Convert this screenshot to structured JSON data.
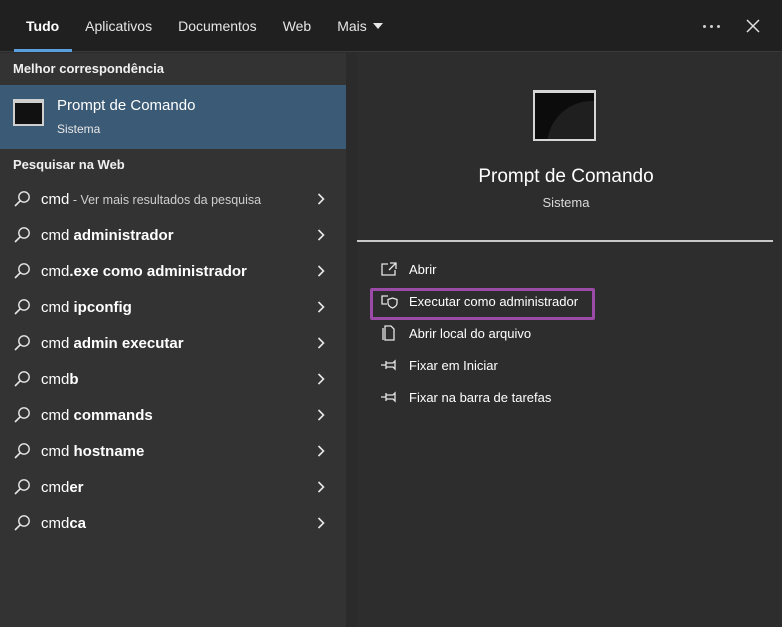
{
  "tabs": [
    {
      "label": "Tudo",
      "active": true
    },
    {
      "label": "Aplicativos"
    },
    {
      "label": "Documentos"
    },
    {
      "label": "Web"
    },
    {
      "label": "Mais"
    }
  ],
  "icons": {
    "more": "ellipsis-icon",
    "close": "close-icon",
    "dropdown": "caret-down-icon",
    "search": "search-icon",
    "chevron": "chevron-right-icon"
  },
  "best_match": {
    "header": "Melhor correspondência",
    "title": "Prompt de Comando",
    "subtitle": "Sistema"
  },
  "web": {
    "header": "Pesquisar na Web",
    "results": [
      {
        "prefix": "cmd",
        "bold": "",
        "note": " - Ver mais resultados da pesquisa"
      },
      {
        "prefix": "cmd ",
        "bold": "administrador",
        "note": ""
      },
      {
        "prefix": "cmd",
        "bold": ".exe como administrador",
        "note": ""
      },
      {
        "prefix": "cmd ",
        "bold": "ipconfig",
        "note": ""
      },
      {
        "prefix": "cmd ",
        "bold": "admin executar",
        "note": ""
      },
      {
        "prefix": "cmd",
        "bold": "b",
        "note": ""
      },
      {
        "prefix": "cmd ",
        "bold": "commands",
        "note": ""
      },
      {
        "prefix": "cmd ",
        "bold": "hostname",
        "note": ""
      },
      {
        "prefix": "cmd",
        "bold": "er",
        "note": ""
      },
      {
        "prefix": "cmd",
        "bold": "ca",
        "note": ""
      }
    ]
  },
  "preview": {
    "title": "Prompt de Comando",
    "subtitle": "Sistema",
    "actions": [
      {
        "label": "Abrir",
        "icon": "open-icon"
      },
      {
        "label": "Executar como administrador",
        "icon": "shield-icon",
        "highlighted": true
      },
      {
        "label": "Abrir local do arquivo",
        "icon": "file-location-icon"
      },
      {
        "label": "Fixar em Iniciar",
        "icon": "pin-icon"
      },
      {
        "label": "Fixar na barra de tarefas",
        "icon": "pin-icon"
      }
    ]
  },
  "colors": {
    "accent": "#5aa0e0",
    "selected_bg": "#3b5a75",
    "highlight_border": "#9c4aa8"
  }
}
